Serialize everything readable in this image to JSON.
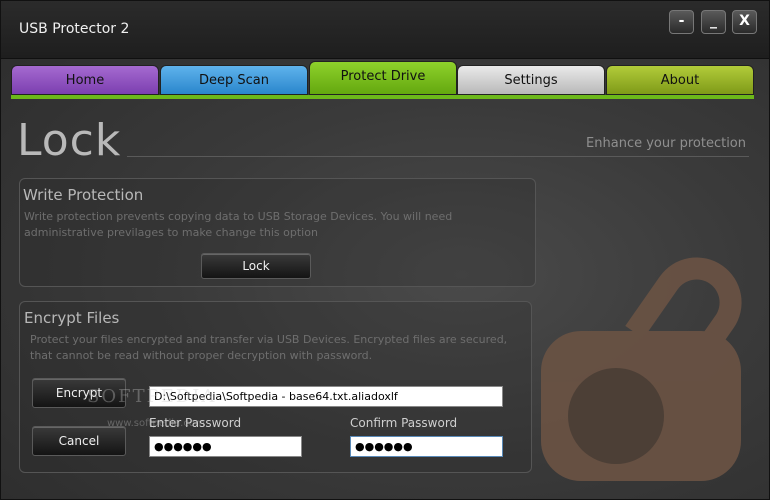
{
  "window": {
    "title": "USB Protector 2",
    "controls": {
      "minimize": "-",
      "maximize": "_",
      "close": "X"
    }
  },
  "tabs": [
    {
      "label": "Home",
      "color": "#8a4fc0"
    },
    {
      "label": "Deep Scan",
      "color": "#3a96da"
    },
    {
      "label": "Protect Drive",
      "color": "#74bb1d",
      "active": true
    },
    {
      "label": "Settings",
      "color": "#cfcfcf"
    },
    {
      "label": "About",
      "color": "#93b025"
    }
  ],
  "header": {
    "title": "Lock",
    "subtitle": "Enhance your protection"
  },
  "write_protection": {
    "title": "Write Protection",
    "desc_line1": "Write protection prevents copying data to USB Storage  Devices. You will need",
    "desc_line2": " administrative previlages to make change this option",
    "lock_label": "Lock"
  },
  "encrypt_files": {
    "title": "Encrypt Files",
    "desc_line1": "Protect your files encrypted and transfer via USB Devices. Encrypted files are secured,",
    "desc_line2": "that cannot be read without proper decryption with password.",
    "encrypt_label": "Encrypt",
    "cancel_label": "Cancel",
    "path_value": "D:\\Softpedia\\Softpedia - base64.txt.aliadoxlf",
    "password_label": "Enter Password",
    "password_value": "●●●●●●",
    "confirm_label": "Confirm Password",
    "confirm_value": "●●●●●●"
  },
  "watermark": {
    "text": "SOFTPEDIA",
    "url": "www.softpedia.com"
  },
  "colors": {
    "accent": "#6cb81a",
    "lock_icon": "#6b5344"
  },
  "icons": {
    "lock_graphic": "padlock-icon"
  }
}
